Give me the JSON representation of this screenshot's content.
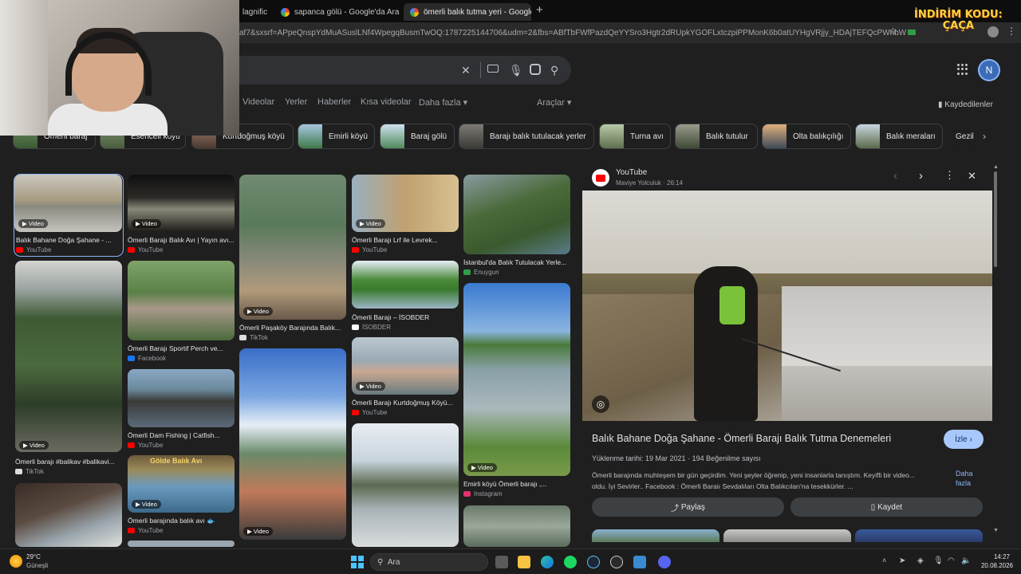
{
  "browser": {
    "tabs": [
      {
        "label": "lagnific"
      },
      {
        "label": "sapanca gölü - Google'da Ara"
      },
      {
        "label": "ömerli balık tutma yeri - Google'da"
      }
    ],
    "new_tab": "+",
    "url": "af7&sxsrf=APpeQnspYdMuASuslLNf4WpegqBusmTwOQ:1787225144706&udm=2&fbs=ABfTbFWfPazdQeYYSro3Hgtr2dRUpkYGOFLxtczpiPPMonK6b0atUYHgVRjjy_HDAjTEFQcPWnbWEQTXhbD...",
    "promo": [
      "İNDİRİM KODU:",
      "ÇAÇA"
    ]
  },
  "nav": {
    "tabs": [
      "Videolar",
      "Yerler",
      "Haberler",
      "Kısa videolar",
      "Daha fazla"
    ],
    "tools": "Araçlar",
    "saved": "Kaydedilenler",
    "avatar_letter": "N"
  },
  "chips": [
    "Ömerli baraj",
    "Esenceli köyü",
    "Kurtdoğmuş köyü",
    "Emirli köyü",
    "Baraj gölü",
    "Barajı balık tutulacak yerler",
    "Turna avı",
    "Balık tutulur",
    "Olta balıkçılığı",
    "Balık meraları",
    "Gezil"
  ],
  "results": [
    {
      "caption": "Balık Bahane Doğa Şahane - ...",
      "source": "YouTube",
      "badge": "Video"
    },
    {
      "caption": "Ömerli barajı #balikav #balikavi...",
      "source": "TikTok",
      "badge": "Video"
    },
    {
      "caption": "Ömerli Barajı Balık Avı | Yayın avı...",
      "source": "YouTube",
      "badge": "Video"
    },
    {
      "caption": "Ömerli Barajı Sportif Perch ve...",
      "source": "Facebook",
      "badge": ""
    },
    {
      "caption": "Ömerli Dam Fishing | Catfish...",
      "source": "YouTube",
      "badge": ""
    },
    {
      "caption": "Ömerli barajında balık avı 🐟",
      "source": "YouTube",
      "badge": "Video",
      "overlay": "Gölde Balık Avı"
    },
    {
      "caption": "Ömerli Paşaköy Barajında Balık...",
      "source": "TikTok",
      "badge": "Video"
    },
    {
      "caption": "Ömerli Barajı Lrf ile Levrek...",
      "source": "YouTube",
      "badge": "Video"
    },
    {
      "caption": "Ömerli Barajı – İSOBDER",
      "source": "İSOBDER",
      "badge": ""
    },
    {
      "caption": "Ömerli Barajı Kurtdoğmuş Köyü...",
      "source": "YouTube",
      "badge": "Video"
    },
    {
      "caption": "İstanbul'da Balık Tutulacak Yerle...",
      "source": "Enuygun",
      "badge": ""
    },
    {
      "caption": "Emirli köyü Ömerli barajı ,...",
      "source": "Instagram",
      "badge": "Video"
    }
  ],
  "panel": {
    "source": "YouTube",
    "channel": "Maviye Yolculuk",
    "duration": "26:14",
    "title": "Balık Bahane Doğa Şahane - Ömerli Barajı Balık Tutma Denemeleri",
    "watch": "İzle",
    "date": "Yüklenme tarihi: 19 Mar 2021",
    "likes": "194 Beğenilme sayısı",
    "desc1": "Ömerli barajında muhteşem bir gün geçirdim. Yeni şeyler öğrenip, yeni insanlarla tanıştım. Keyifli bir video...",
    "desc2": "oldu. İyi Sevirler.. Facebook : Ömerli Baraiı Sevdalıları Olta Balıkcıları'na tesekkürler. ...",
    "more": "Daha fazla",
    "share": "Paylaş",
    "save": "Kaydet"
  },
  "taskbar": {
    "temp": "29°C",
    "weather": "Güneşli",
    "search": "Ara",
    "time": "14:27",
    "date": "20.08.2026"
  }
}
